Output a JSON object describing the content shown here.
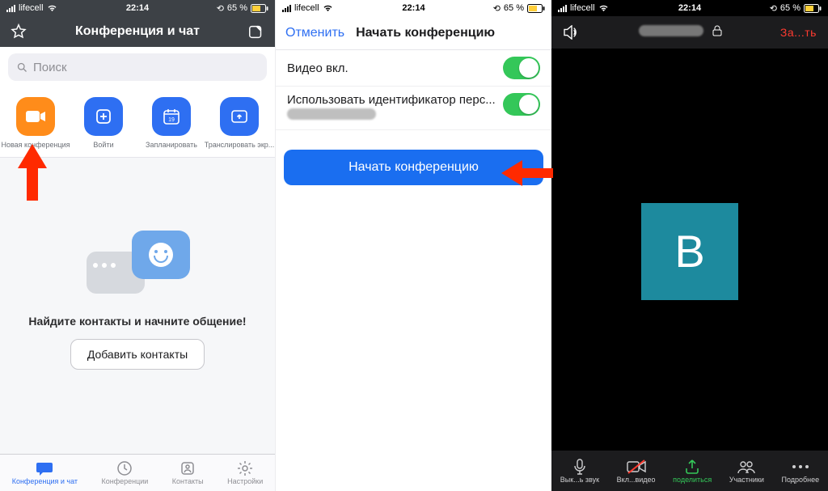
{
  "status": {
    "carrier": "lifecell",
    "time": "22:14",
    "battery": "65 %"
  },
  "panel1": {
    "title": "Конференция и чат",
    "search_placeholder": "Поиск",
    "actions": {
      "new_conf": "Новая конференция",
      "join": "Войти",
      "schedule": "Запланировать",
      "share": "Транслировать экр..."
    },
    "empty_text": "Найдите контакты и начните общение!",
    "add_contacts": "Добавить контакты",
    "tabs": {
      "conf_chat": "Конференция и чат",
      "conferences": "Конференции",
      "contacts": "Контакты",
      "settings": "Настройки"
    }
  },
  "panel2": {
    "cancel": "Отменить",
    "title": "Начать конференцию",
    "video_on": "Видео вкл.",
    "use_pmi": "Использовать идентификатор перс...",
    "start_btn": "Начать конференцию"
  },
  "panel3": {
    "end": "За...ть",
    "avatar_letter": "В",
    "tabs": {
      "mute": "Вык...ь звук",
      "video": "Вкл...видео",
      "share": "поделиться",
      "participants": "Участники",
      "more": "Подробнее"
    }
  }
}
